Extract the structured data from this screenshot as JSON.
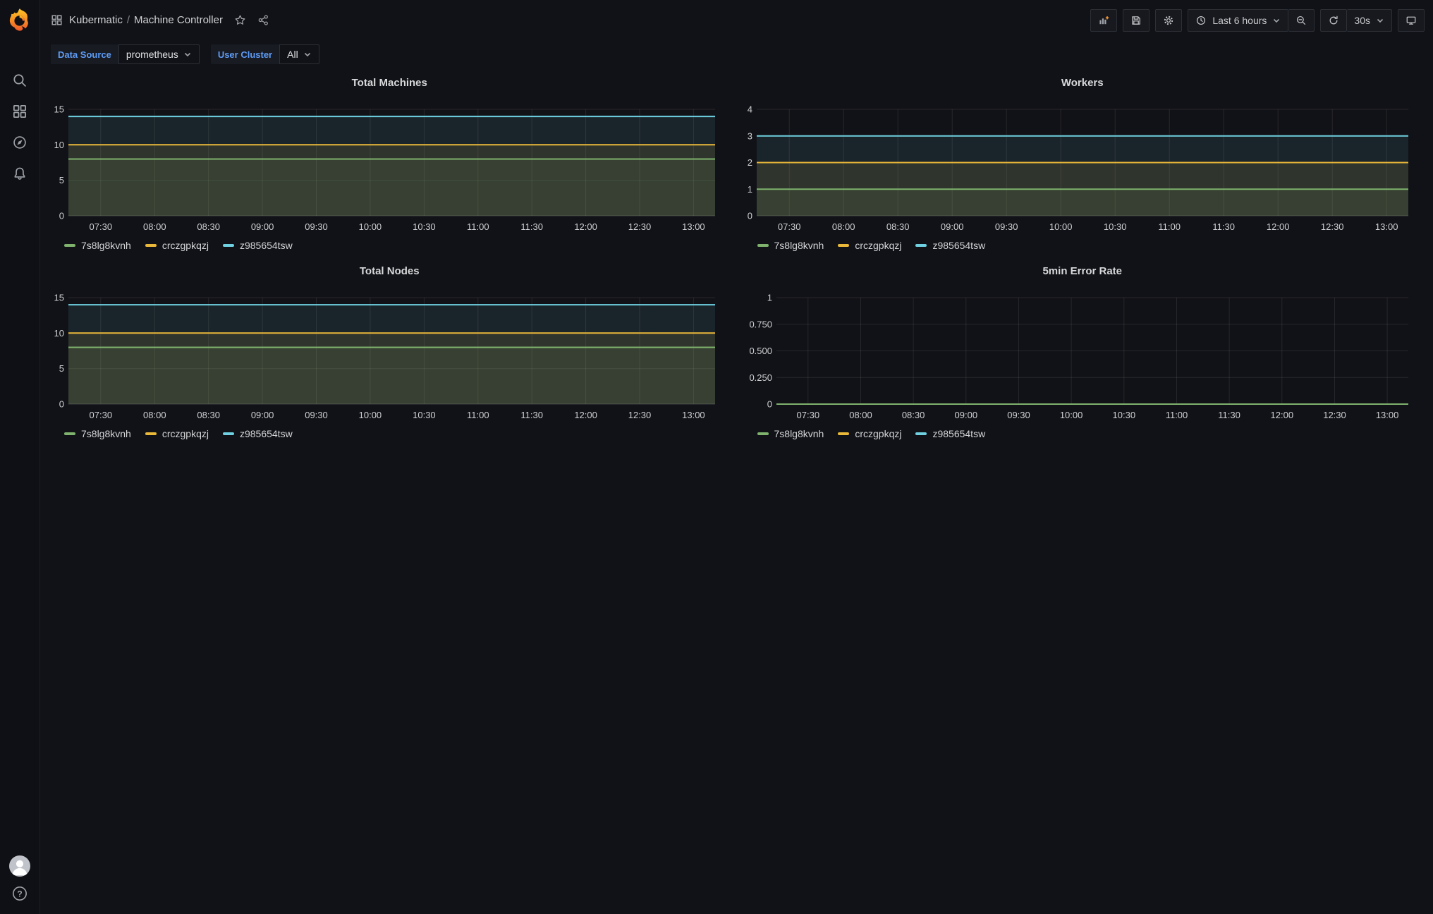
{
  "header": {
    "breadcrumb": {
      "folder": "Kubermatic",
      "separator": "/",
      "dashboard": "Machine Controller"
    },
    "time_range": "Last 6 hours",
    "refresh_interval": "30s"
  },
  "variables": [
    {
      "label": "Data Source",
      "value": "prometheus"
    },
    {
      "label": "User Cluster",
      "value": "All"
    }
  ],
  "colors": {
    "page_bg": "#111217",
    "sidebar_bg": "#0e1015",
    "series_green": "#7EB26D",
    "series_yellow": "#EAB839",
    "series_cyan": "#6ED0E0",
    "variable_label_blue": "#5e9cf5",
    "add_panel_plus_orange": "#ff9830"
  },
  "icons": {
    "grafana-logo": "orange flame swirl",
    "search-icon": "magnifier",
    "dashboards-icon": "four squares grid",
    "explore-compass-icon": "compass",
    "alerting-bell-icon": "bell",
    "avatar": "person silhouette circle",
    "help-icon": "question mark circle",
    "add-panel-icon": "bar chart with plus",
    "save-icon": "floppy disk",
    "settings-gear-icon": "gear",
    "clock-icon": "clock",
    "chevron-down-icon": "chevron down",
    "zoom-out-icon": "magnifier with minus",
    "refresh-icon": "circular arrow",
    "kiosk-monitor-icon": "monitor",
    "star-icon": "star outline",
    "share-icon": "share nodes"
  },
  "chart_data": [
    {
      "type": "line",
      "title": "Total Machines",
      "x_start": "07:12",
      "x_end": "13:12",
      "xticks": [
        "07:30",
        "08:00",
        "08:30",
        "09:00",
        "09:30",
        "10:00",
        "10:30",
        "11:00",
        "11:30",
        "12:00",
        "12:30",
        "13:00"
      ],
      "ylim": [
        0,
        15
      ],
      "yticks": [
        0,
        5,
        10,
        15
      ],
      "ytick_labels": [
        "0",
        "5",
        "10",
        "15"
      ],
      "series": [
        {
          "name": "7s8lg8kvnh",
          "color": "#7EB26D",
          "value": 8
        },
        {
          "name": "crczgpkqzj",
          "color": "#EAB839",
          "value": 10
        },
        {
          "name": "z985654tsw",
          "color": "#6ED0E0",
          "value": 14
        }
      ],
      "fill_opacity": 0.1,
      "grid": true,
      "legend_position": "bottom-left"
    },
    {
      "type": "line",
      "title": "Workers",
      "x_start": "07:12",
      "x_end": "13:12",
      "xticks": [
        "07:30",
        "08:00",
        "08:30",
        "09:00",
        "09:30",
        "10:00",
        "10:30",
        "11:00",
        "11:30",
        "12:00",
        "12:30",
        "13:00"
      ],
      "ylim": [
        0,
        4
      ],
      "yticks": [
        0,
        1,
        2,
        3,
        4
      ],
      "ytick_labels": [
        "0",
        "1",
        "2",
        "3",
        "4"
      ],
      "series": [
        {
          "name": "7s8lg8kvnh",
          "color": "#7EB26D",
          "value": 1
        },
        {
          "name": "crczgpkqzj",
          "color": "#EAB839",
          "value": 2
        },
        {
          "name": "z985654tsw",
          "color": "#6ED0E0",
          "value": 3
        }
      ],
      "fill_opacity": 0.1,
      "grid": true,
      "legend_position": "bottom-left"
    },
    {
      "type": "line",
      "title": "Total Nodes",
      "x_start": "07:12",
      "x_end": "13:12",
      "xticks": [
        "07:30",
        "08:00",
        "08:30",
        "09:00",
        "09:30",
        "10:00",
        "10:30",
        "11:00",
        "11:30",
        "12:00",
        "12:30",
        "13:00"
      ],
      "ylim": [
        0,
        15
      ],
      "yticks": [
        0,
        5,
        10,
        15
      ],
      "ytick_labels": [
        "0",
        "5",
        "10",
        "15"
      ],
      "series": [
        {
          "name": "7s8lg8kvnh",
          "color": "#7EB26D",
          "value": 8
        },
        {
          "name": "crczgpkqzj",
          "color": "#EAB839",
          "value": 10
        },
        {
          "name": "z985654tsw",
          "color": "#6ED0E0",
          "value": 14
        }
      ],
      "fill_opacity": 0.1,
      "grid": true,
      "legend_position": "bottom-left"
    },
    {
      "type": "line",
      "title": "5min Error Rate",
      "x_start": "07:12",
      "x_end": "13:12",
      "xticks": [
        "07:30",
        "08:00",
        "08:30",
        "09:00",
        "09:30",
        "10:00",
        "10:30",
        "11:00",
        "11:30",
        "12:00",
        "12:30",
        "13:00"
      ],
      "ylim": [
        0,
        1
      ],
      "yticks": [
        0,
        0.25,
        0.5,
        0.75,
        1
      ],
      "ytick_labels": [
        "0",
        "0.250",
        "0.500",
        "0.750",
        "1"
      ],
      "series": [
        {
          "name": "7s8lg8kvnh",
          "color": "#7EB26D",
          "value": 0
        },
        {
          "name": "crczgpkqzj",
          "color": "#EAB839",
          "value": 0
        },
        {
          "name": "z985654tsw",
          "color": "#6ED0E0",
          "value": 0
        }
      ],
      "fill_opacity": 0.1,
      "grid": true,
      "legend_position": "bottom-left"
    }
  ]
}
